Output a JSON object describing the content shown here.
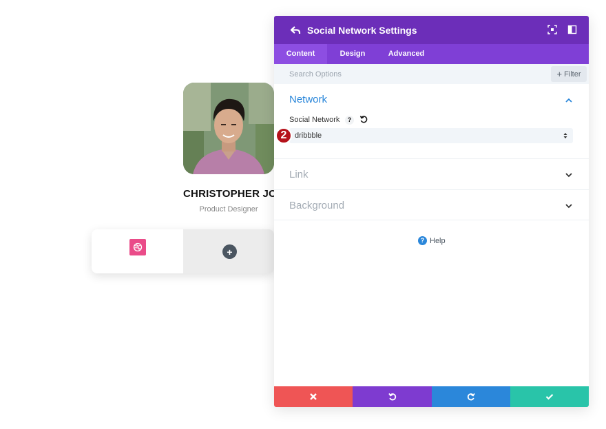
{
  "profile": {
    "name": "CHRISTOPHER JOE",
    "role": "Product Designer",
    "social_icon": "dribbble-icon",
    "add_icon": "plus-icon"
  },
  "panel": {
    "title": "Social Network Settings",
    "tabs": [
      {
        "label": "Content",
        "active": true
      },
      {
        "label": "Design",
        "active": false
      },
      {
        "label": "Advanced",
        "active": false
      }
    ],
    "search": {
      "placeholder": "Search Options"
    },
    "filter_label": "Filter",
    "sections": [
      {
        "title": "Network",
        "expanded": true
      },
      {
        "title": "Link",
        "expanded": false
      },
      {
        "title": "Background",
        "expanded": false
      }
    ],
    "field": {
      "label": "Social Network",
      "value": "dribbble",
      "step_badge": "2"
    },
    "help_label": "Help"
  },
  "colors": {
    "header": "#6c2eb9",
    "tabs": "#7f3fd6",
    "active_tab": "#8d4ee2",
    "section_active": "#2b87da",
    "cancel": "#ef5555",
    "undo": "#7e3bd0",
    "redo": "#2b87da",
    "save": "#29c4a9",
    "dribbble": "#ea4c89"
  }
}
